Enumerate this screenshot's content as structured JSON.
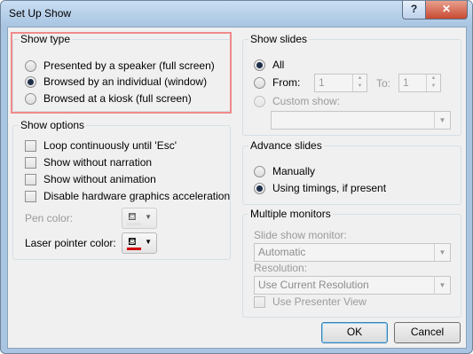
{
  "window": {
    "title": "Set Up Show",
    "help_glyph": "?",
    "close_glyph": "✕"
  },
  "show_type": {
    "title": "Show type",
    "options": [
      "Presented by a speaker (full screen)",
      "Browsed by an individual (window)",
      "Browsed at a kiosk (full screen)"
    ],
    "selected": 1
  },
  "show_options": {
    "title": "Show options",
    "checks": [
      "Loop continuously until 'Esc'",
      "Show without narration",
      "Show without animation",
      "Disable hardware graphics acceleration"
    ],
    "pen_color_label": "Pen color:",
    "laser_color_label": "Laser pointer color:",
    "laser_color": "#d20000",
    "pen_color": "#d8d8d8"
  },
  "show_slides": {
    "title": "Show slides",
    "all_label": "All",
    "from_label": "From:",
    "from_value": "1",
    "to_label": "To:",
    "to_value": "1",
    "custom_label": "Custom show:"
  },
  "advance_slides": {
    "title": "Advance slides",
    "options": [
      "Manually",
      "Using timings, if present"
    ],
    "selected": 1
  },
  "multiple_monitors": {
    "title": "Multiple monitors",
    "monitor_label": "Slide show monitor:",
    "monitor_value": "Automatic",
    "resolution_label": "Resolution:",
    "resolution_value": "Use Current Resolution",
    "presenter_view_label": "Use Presenter View"
  },
  "buttons": {
    "ok": "OK",
    "cancel": "Cancel"
  }
}
